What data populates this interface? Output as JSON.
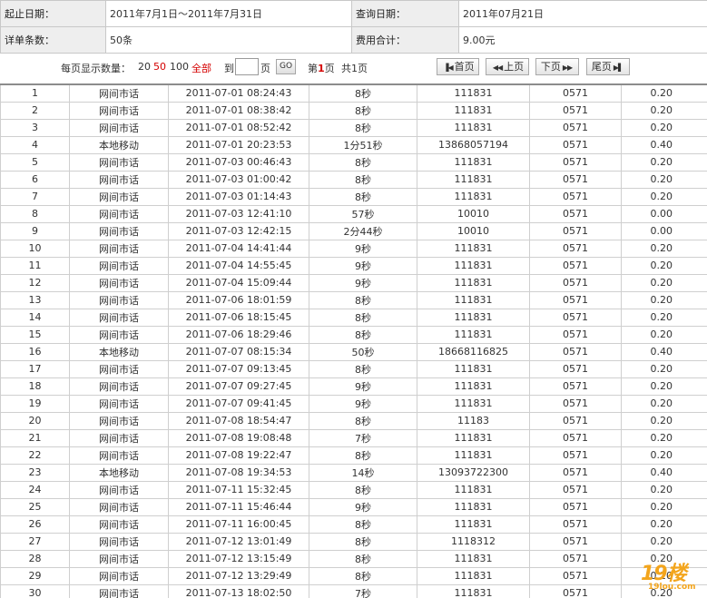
{
  "summary": {
    "date_range_label": "起止日期：",
    "date_range_value": "2011年7月1日～2011年7月31日",
    "query_date_label": "查询日期：",
    "query_date_value": "2011年07月21日",
    "count_label": "详单条数：",
    "count_value": "50条",
    "fee_total_label": "费用合计：",
    "fee_total_value": "9.00元"
  },
  "pager": {
    "per_page_label": "每页显示数量：",
    "opt_20": "20",
    "opt_50": "50",
    "opt_100": "100",
    "opt_all": "全部",
    "goto_label": "到",
    "page_unit": "页",
    "go_label": "GO",
    "page_prefix": "第",
    "page_current": "1",
    "page_suffix": "页",
    "page_total": "共1页",
    "first_label": "首页",
    "prev_label": "上页",
    "next_label": "下页",
    "last_label": "尾页"
  },
  "rows": [
    [
      "1",
      "网间市话",
      "2011-07-01 08:24:43",
      "8秒",
      "111831",
      "0571",
      "0.20"
    ],
    [
      "2",
      "网间市话",
      "2011-07-01 08:38:42",
      "8秒",
      "111831",
      "0571",
      "0.20"
    ],
    [
      "3",
      "网间市话",
      "2011-07-01 08:52:42",
      "8秒",
      "111831",
      "0571",
      "0.20"
    ],
    [
      "4",
      "本地移动",
      "2011-07-01 20:23:53",
      "1分51秒",
      "13868057194",
      "0571",
      "0.40"
    ],
    [
      "5",
      "网间市话",
      "2011-07-03 00:46:43",
      "8秒",
      "111831",
      "0571",
      "0.20"
    ],
    [
      "6",
      "网间市话",
      "2011-07-03 01:00:42",
      "8秒",
      "111831",
      "0571",
      "0.20"
    ],
    [
      "7",
      "网间市话",
      "2011-07-03 01:14:43",
      "8秒",
      "111831",
      "0571",
      "0.20"
    ],
    [
      "8",
      "网间市话",
      "2011-07-03 12:41:10",
      "57秒",
      "10010",
      "0571",
      "0.00"
    ],
    [
      "9",
      "网间市话",
      "2011-07-03 12:42:15",
      "2分44秒",
      "10010",
      "0571",
      "0.00"
    ],
    [
      "10",
      "网间市话",
      "2011-07-04 14:41:44",
      "9秒",
      "111831",
      "0571",
      "0.20"
    ],
    [
      "11",
      "网间市话",
      "2011-07-04 14:55:45",
      "9秒",
      "111831",
      "0571",
      "0.20"
    ],
    [
      "12",
      "网间市话",
      "2011-07-04 15:09:44",
      "9秒",
      "111831",
      "0571",
      "0.20"
    ],
    [
      "13",
      "网间市话",
      "2011-07-06 18:01:59",
      "8秒",
      "111831",
      "0571",
      "0.20"
    ],
    [
      "14",
      "网间市话",
      "2011-07-06 18:15:45",
      "8秒",
      "111831",
      "0571",
      "0.20"
    ],
    [
      "15",
      "网间市话",
      "2011-07-06 18:29:46",
      "8秒",
      "111831",
      "0571",
      "0.20"
    ],
    [
      "16",
      "本地移动",
      "2011-07-07 08:15:34",
      "50秒",
      "18668116825",
      "0571",
      "0.40"
    ],
    [
      "17",
      "网间市话",
      "2011-07-07 09:13:45",
      "8秒",
      "111831",
      "0571",
      "0.20"
    ],
    [
      "18",
      "网间市话",
      "2011-07-07 09:27:45",
      "9秒",
      "111831",
      "0571",
      "0.20"
    ],
    [
      "19",
      "网间市话",
      "2011-07-07 09:41:45",
      "9秒",
      "111831",
      "0571",
      "0.20"
    ],
    [
      "20",
      "网间市话",
      "2011-07-08 18:54:47",
      "8秒",
      "11183",
      "0571",
      "0.20"
    ],
    [
      "21",
      "网间市话",
      "2011-07-08 19:08:48",
      "7秒",
      "111831",
      "0571",
      "0.20"
    ],
    [
      "22",
      "网间市话",
      "2011-07-08 19:22:47",
      "8秒",
      "111831",
      "0571",
      "0.20"
    ],
    [
      "23",
      "本地移动",
      "2011-07-08 19:34:53",
      "14秒",
      "13093722300",
      "0571",
      "0.40"
    ],
    [
      "24",
      "网间市话",
      "2011-07-11 15:32:45",
      "8秒",
      "111831",
      "0571",
      "0.20"
    ],
    [
      "25",
      "网间市话",
      "2011-07-11 15:46:44",
      "9秒",
      "111831",
      "0571",
      "0.20"
    ],
    [
      "26",
      "网间市话",
      "2011-07-11 16:00:45",
      "8秒",
      "111831",
      "0571",
      "0.20"
    ],
    [
      "27",
      "网间市话",
      "2011-07-12 13:01:49",
      "8秒",
      "1118312",
      "0571",
      "0.20"
    ],
    [
      "28",
      "网间市话",
      "2011-07-12 13:15:49",
      "8秒",
      "111831",
      "0571",
      "0.20"
    ],
    [
      "29",
      "网间市话",
      "2011-07-12 13:29:49",
      "8秒",
      "111831",
      "0571",
      "0.20"
    ],
    [
      "30",
      "网间市话",
      "2011-07-13 18:02:50",
      "7秒",
      "111831",
      "0571",
      "0.20"
    ]
  ],
  "watermark": {
    "logo_text": "19楼",
    "site_text": "19lou.com"
  }
}
